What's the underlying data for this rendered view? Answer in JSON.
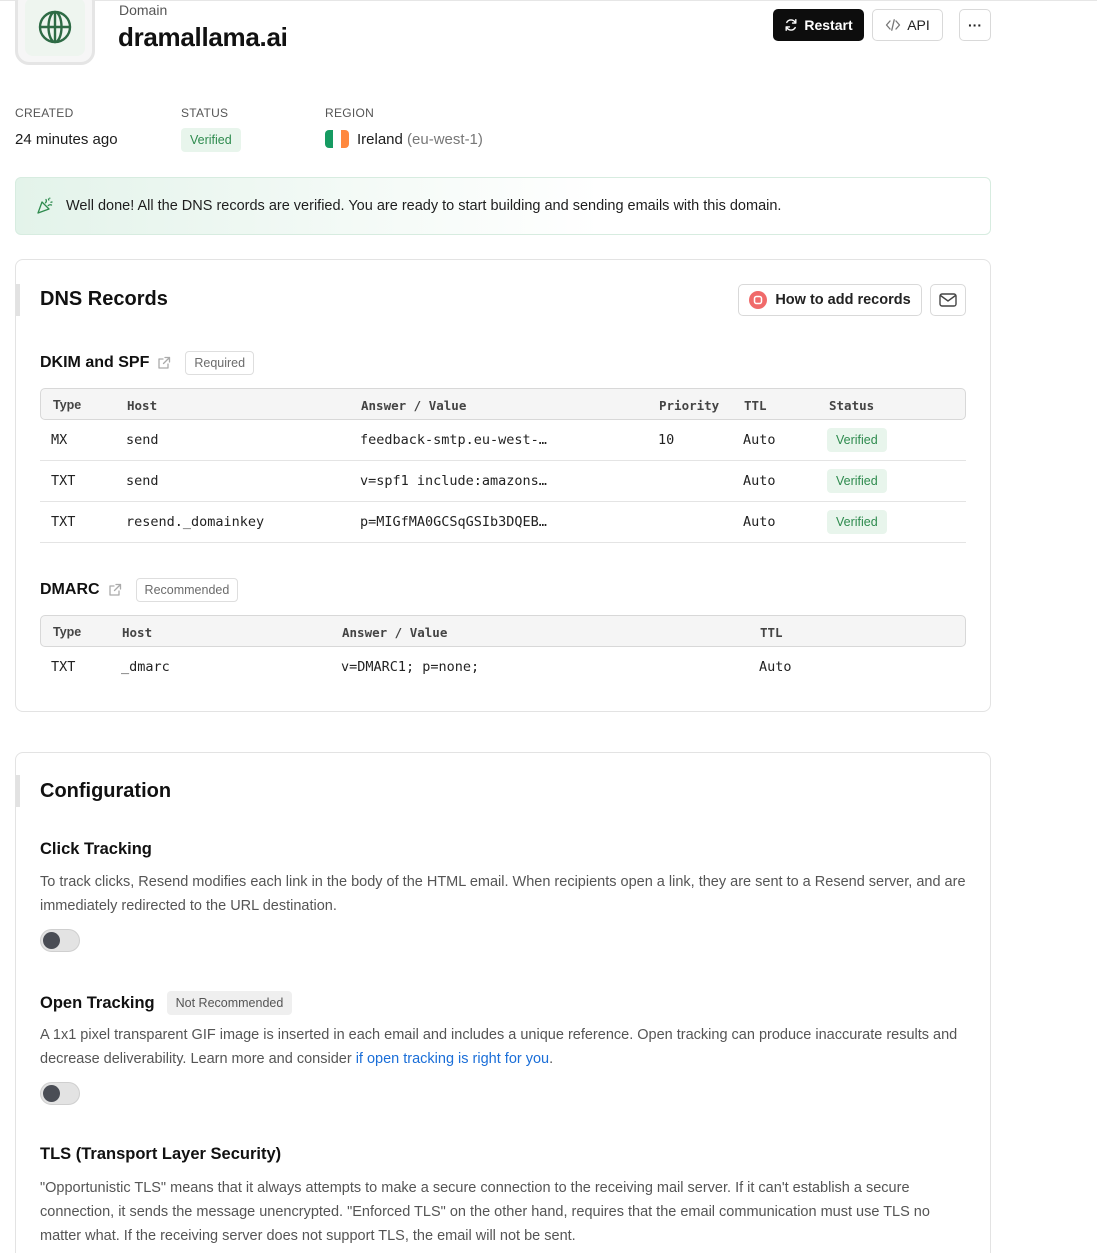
{
  "header": {
    "kicker": "Domain",
    "domain": "dramallama.ai",
    "restart_label": "Restart",
    "api_label": "API",
    "more_label": "···"
  },
  "meta": {
    "created_label": "CREATED",
    "created_value": "24 minutes ago",
    "status_label": "STATUS",
    "status_value": "Verified",
    "region_label": "REGION",
    "region_name": "Ireland",
    "region_code": "(eu-west-1)",
    "flag_colors": [
      "#169b62",
      "#ffffff",
      "#ff883e"
    ]
  },
  "banner": {
    "text": "Well done! All the DNS records are verified. You are ready to start building and sending emails with this domain."
  },
  "dns": {
    "title": "DNS Records",
    "howto_label": "How to add records",
    "dkim": {
      "title": "DKIM and SPF",
      "tag": "Required",
      "columns": [
        "Type",
        "Host",
        "Answer / Value",
        "Priority",
        "TTL",
        "Status"
      ],
      "rows": [
        {
          "type": "MX",
          "host": "send",
          "value": "feedback-smtp.eu-west-…",
          "priority": "10",
          "ttl": "Auto",
          "status": "Verified"
        },
        {
          "type": "TXT",
          "host": "send",
          "value": "v=spf1 include:amazons…",
          "priority": "",
          "ttl": "Auto",
          "status": "Verified"
        },
        {
          "type": "TXT",
          "host": "resend._domainkey",
          "value": "p=MIGfMA0GCSqGSIb3DQEB…",
          "priority": "",
          "ttl": "Auto",
          "status": "Verified"
        }
      ]
    },
    "dmarc": {
      "title": "DMARC",
      "tag": "Recommended",
      "columns": [
        "Type",
        "Host",
        "Answer / Value",
        "TTL"
      ],
      "rows": [
        {
          "type": "TXT",
          "host": "_dmarc",
          "value": "v=DMARC1; p=none;",
          "ttl": "Auto"
        }
      ]
    }
  },
  "config": {
    "title": "Configuration",
    "click": {
      "title": "Click Tracking",
      "desc": "To track clicks, Resend modifies each link in the body of the HTML email. When recipients open a link, they are sent to a Resend server, and are immediately redirected to the URL destination.",
      "enabled": false
    },
    "open": {
      "title": "Open Tracking",
      "tag": "Not Recommended",
      "desc": "A 1x1 pixel transparent GIF image is inserted in each email and includes a unique reference. Open tracking can produce inaccurate results and decrease deliverability. Learn more and consider",
      "link": "if open tracking is right for you",
      "desc_end": ".",
      "enabled": false
    },
    "tls": {
      "title": "TLS (Transport Layer Security)",
      "desc": "\"Opportunistic TLS\" means that it always attempts to make a secure connection to the receiving mail server. If it can't establish a secure connection, it sends the message unencrypted. \"Enforced TLS\" on the other hand, requires that the email communication must use TLS no matter what. If the receiving server does not support TLS, the email will not be sent."
    }
  },
  "colors": {
    "verified_bg": "#e8f5ec",
    "verified_text": "#2e8b4e",
    "link": "#1a6ed8",
    "primary_button": "#0d0d0d"
  }
}
